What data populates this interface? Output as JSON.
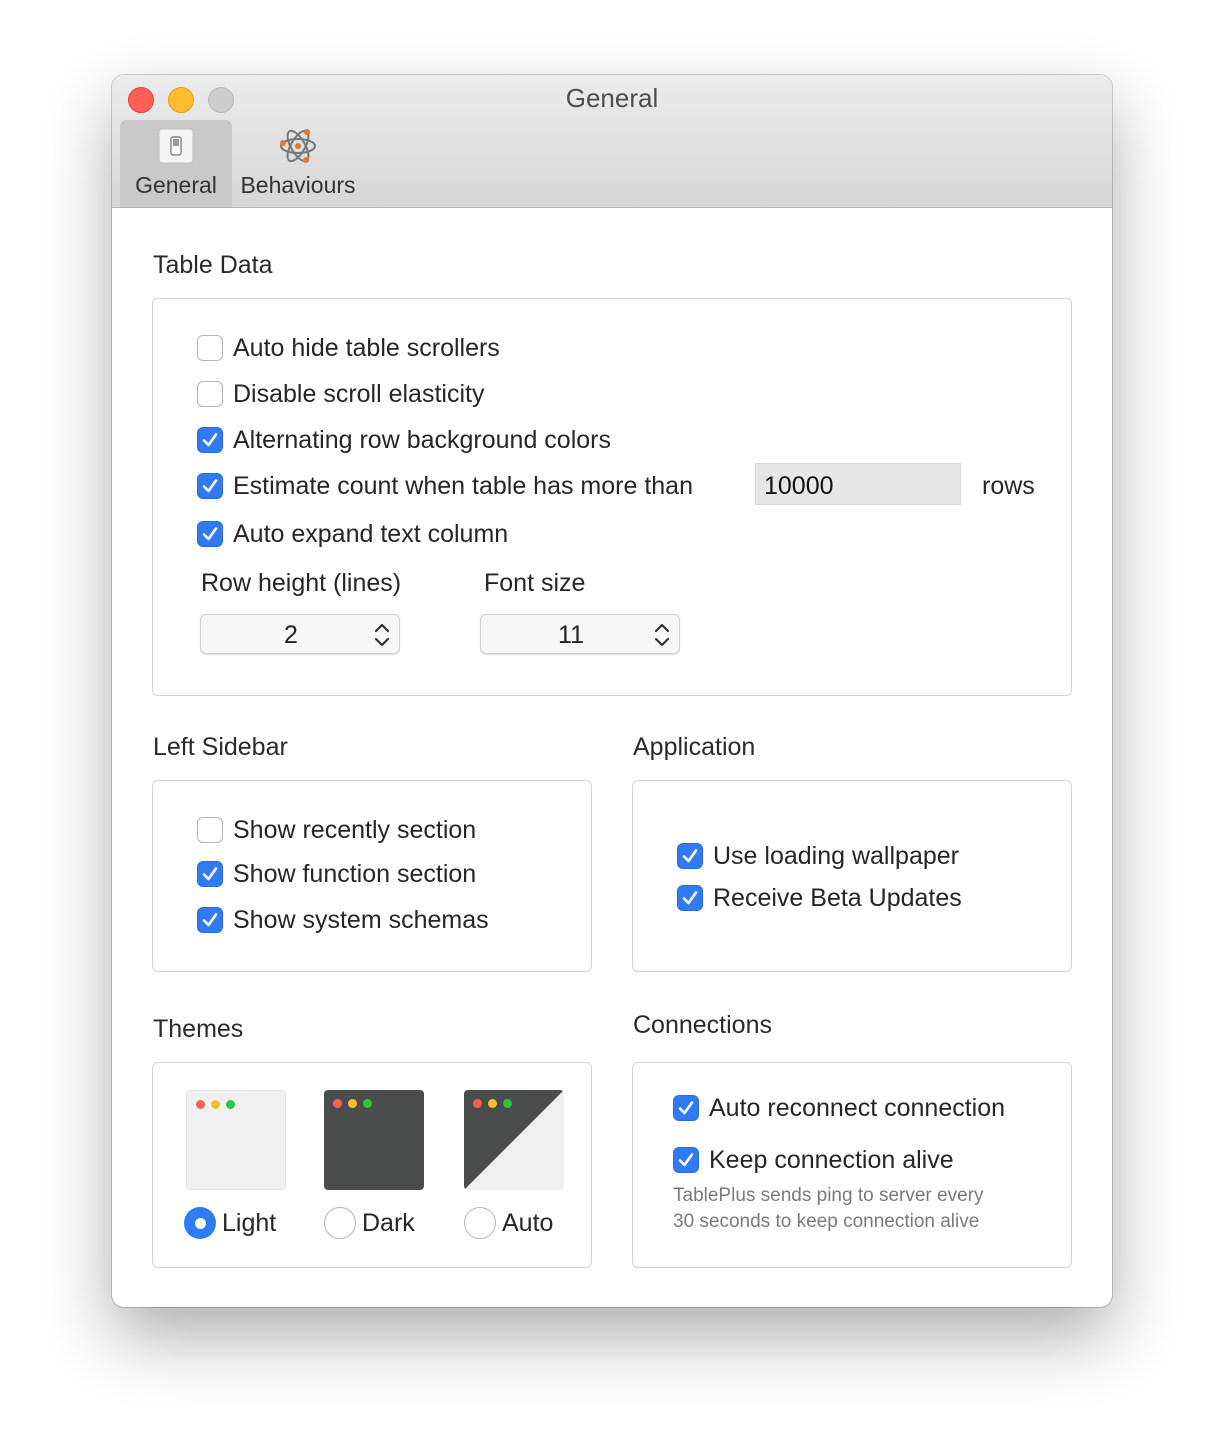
{
  "window": {
    "title": "General",
    "traffic_lights": {
      "close": "#ff5f57",
      "minimize": "#febc2e",
      "zoom": "#cdcdcd"
    }
  },
  "toolbar": {
    "tabs": [
      {
        "label": "General",
        "icon": "toggle-switch-icon",
        "selected": true
      },
      {
        "label": "Behaviours",
        "icon": "atom-icon",
        "selected": false
      }
    ]
  },
  "table_data": {
    "title": "Table Data",
    "options": [
      {
        "label": "Auto hide table scrollers",
        "checked": false
      },
      {
        "label": "Disable scroll elasticity",
        "checked": false
      },
      {
        "label": "Alternating row background colors",
        "checked": true
      },
      {
        "label": "Estimate count when table has more than",
        "checked": true
      },
      {
        "label": "Auto expand text column",
        "checked": true
      }
    ],
    "estimate_value": "10000",
    "estimate_suffix": "rows",
    "row_height_label": "Row height (lines)",
    "row_height_value": "2",
    "font_size_label": "Font size",
    "font_size_value": "11"
  },
  "left_sidebar": {
    "title": "Left Sidebar",
    "options": [
      {
        "label": "Show recently section",
        "checked": false
      },
      {
        "label": "Show function section",
        "checked": true
      },
      {
        "label": "Show system schemas",
        "checked": true
      }
    ]
  },
  "application": {
    "title": "Application",
    "options": [
      {
        "label": "Use loading wallpaper",
        "checked": true
      },
      {
        "label": "Receive Beta Updates",
        "checked": true
      }
    ]
  },
  "themes": {
    "title": "Themes",
    "selected": "Light",
    "options": [
      {
        "label": "Light"
      },
      {
        "label": "Dark"
      },
      {
        "label": "Auto"
      }
    ]
  },
  "connections": {
    "title": "Connections",
    "options": [
      {
        "label": "Auto reconnect connection",
        "checked": true
      },
      {
        "label": "Keep connection alive",
        "checked": true
      }
    ],
    "note_line1": "TablePlus sends ping to server every",
    "note_line2": "30 seconds to keep connection alive"
  },
  "colors": {
    "accent": "#2f7bf5",
    "dark_theme": "#4b4d4c",
    "light_theme": "#f0f0f0"
  }
}
